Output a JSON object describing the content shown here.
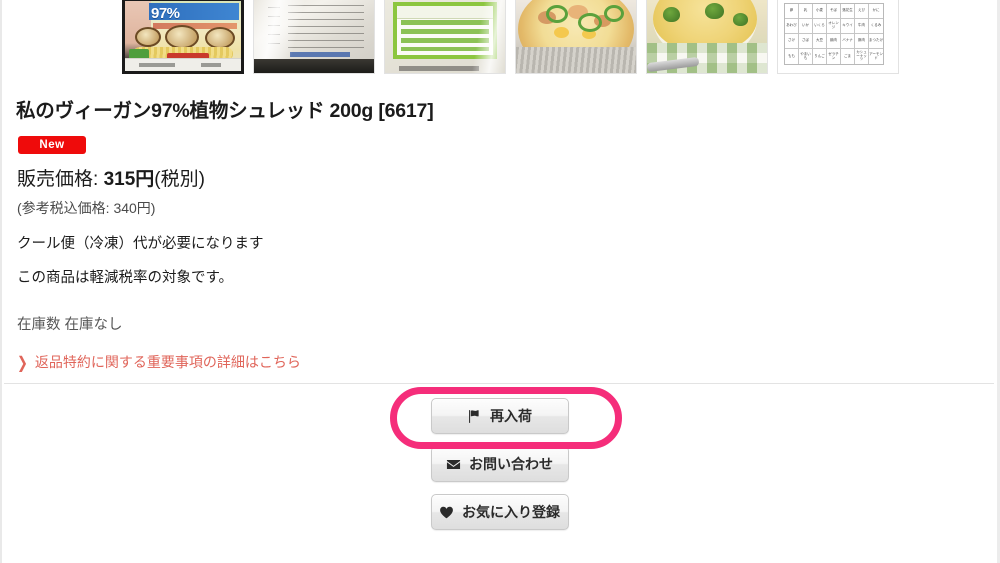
{
  "gallery": {
    "name": "product-image-thumbnails",
    "thumbnails": [
      {
        "name": "thumb-package-front",
        "alt": "97%植物シュレッド パッケージ表面",
        "selected": true
      },
      {
        "name": "thumb-package-back-label",
        "alt": "パッケージ裏面 表示ラベル",
        "selected": false
      },
      {
        "name": "thumb-nutrition-table",
        "alt": "栄養成分表（緑の表）",
        "selected": false
      },
      {
        "name": "thumb-pizza-dish",
        "alt": "ピザ 調理例",
        "selected": false
      },
      {
        "name": "thumb-gratin-dish",
        "alt": "グラタン 調理例",
        "selected": false
      },
      {
        "name": "thumb-allergen-table",
        "alt": "アレルギー物質一覧表",
        "selected": false
      }
    ],
    "allergen_table": {
      "rows": [
        [
          "卵",
          "乳",
          "小麦",
          "そば",
          "落花生",
          "えび",
          "かに"
        ],
        [
          "あわび",
          "いか",
          "いくら",
          "オレンジ",
          "キウイ",
          "牛肉",
          "くるみ"
        ],
        [
          "さけ",
          "さば",
          "大豆",
          "鶏肉",
          "バナナ",
          "豚肉",
          "まつたけ"
        ],
        [
          "もも",
          "やまいも",
          "りんご",
          "ゼラチン",
          "ごま",
          "カシューナッツ",
          "アーモンド"
        ]
      ]
    }
  },
  "product": {
    "title": "私のヴィーガン97%植物シュレッド 200g [6617]",
    "badge": "New",
    "price_label": "販売価格:",
    "price_amount": "315円",
    "price_tax_note": "(税別)",
    "price_incl_tax": "(参考税込価格: 340円)",
    "notes": [
      "クール便（冷凍）代が必要になります",
      "この商品は軽減税率の対象です。"
    ],
    "stock_label": "在庫数",
    "stock_value": "在庫なし",
    "policy_link": "返品特約に関する重要事項の詳細はこちら",
    "policy_chevron": "❯"
  },
  "actions": {
    "restock": {
      "label": "再入荷",
      "icon": "flag-icon"
    },
    "contact": {
      "label": "お問い合わせ",
      "icon": "envelope-icon"
    },
    "favorite": {
      "label": "お気に入り登録",
      "icon": "heart-icon"
    }
  },
  "highlight": {
    "target": "restock-button",
    "color": "#f52d7a"
  }
}
